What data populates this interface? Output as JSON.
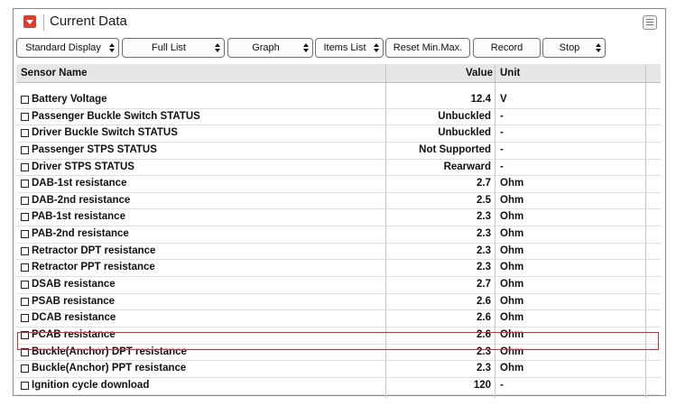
{
  "window": {
    "title": "Current Data"
  },
  "toolbar": {
    "buttons": [
      {
        "label": "Standard Display",
        "spin": true
      },
      {
        "label": "Full List",
        "spin": true
      },
      {
        "label": "Graph",
        "spin": true
      },
      {
        "label": "Items List",
        "spin": true
      },
      {
        "label": "Reset Min.Max.",
        "spin": false
      },
      {
        "label": "Record",
        "spin": false
      },
      {
        "label": "Stop",
        "spin": true
      }
    ]
  },
  "table": {
    "columns": {
      "name": "Sensor Name",
      "value": "Value",
      "unit": "Unit"
    },
    "rows": [
      {
        "name": "Battery Voltage",
        "value": "12.4",
        "unit": "V"
      },
      {
        "name": "Passenger Buckle Switch STATUS",
        "value": "Unbuckled",
        "unit": "-"
      },
      {
        "name": "Driver Buckle Switch STATUS",
        "value": "Unbuckled",
        "unit": "-"
      },
      {
        "name": "Passenger STPS STATUS",
        "value": "Not Supported",
        "unit": "-"
      },
      {
        "name": "Driver STPS STATUS",
        "value": "Rearward",
        "unit": "-"
      },
      {
        "name": "DAB-1st resistance",
        "value": "2.7",
        "unit": "Ohm"
      },
      {
        "name": "DAB-2nd resistance",
        "value": "2.5",
        "unit": "Ohm"
      },
      {
        "name": "PAB-1st resistance",
        "value": "2.3",
        "unit": "Ohm"
      },
      {
        "name": "PAB-2nd resistance",
        "value": "2.3",
        "unit": "Ohm"
      },
      {
        "name": "Retractor DPT resistance",
        "value": "2.3",
        "unit": "Ohm"
      },
      {
        "name": "Retractor PPT resistance",
        "value": "2.3",
        "unit": "Ohm"
      },
      {
        "name": "DSAB resistance",
        "value": "2.7",
        "unit": "Ohm"
      },
      {
        "name": "PSAB resistance",
        "value": "2.6",
        "unit": "Ohm"
      },
      {
        "name": "DCAB resistance",
        "value": "2.6",
        "unit": "Ohm"
      },
      {
        "name": "PCAB resistance",
        "value": "2.6",
        "unit": "Ohm"
      },
      {
        "name": "Buckle(Anchor) DPT resistance",
        "value": "2.3",
        "unit": "Ohm"
      },
      {
        "name": "Buckle(Anchor) PPT resistance",
        "value": "2.3",
        "unit": "Ohm"
      },
      {
        "name": "Ignition cycle download",
        "value": "120",
        "unit": "-"
      }
    ]
  },
  "colors": {
    "highlight": "#e0292e",
    "title_icon": "#d8412f",
    "header_bg": "#e6e6e6"
  },
  "icons": {
    "title": "dropdown-arrow-icon",
    "menu": "list-menu-icon"
  }
}
